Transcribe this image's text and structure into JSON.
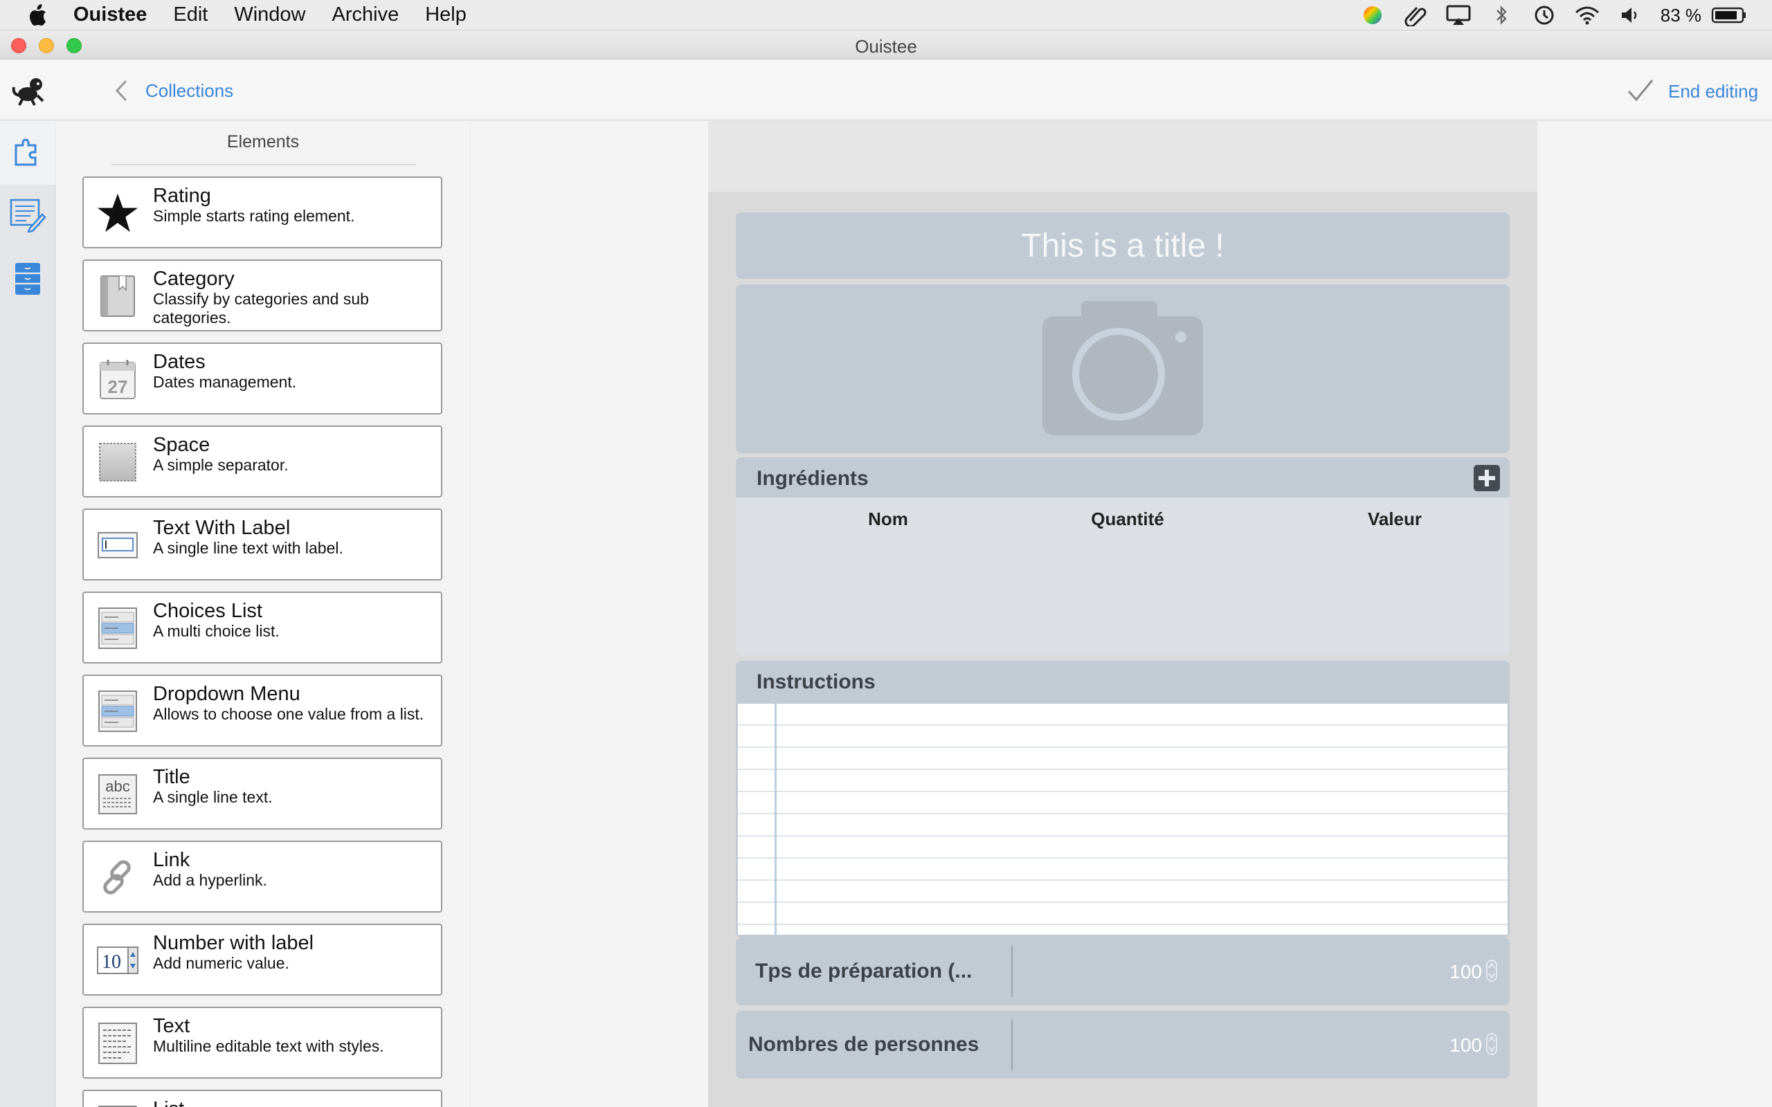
{
  "menubar": {
    "app_name": "Ouistee",
    "items": [
      "Edit",
      "Window",
      "Archive",
      "Help"
    ],
    "battery_percent": "83 %"
  },
  "window": {
    "title": "Ouistee"
  },
  "toolbar": {
    "back_label": "Collections",
    "end_editing_label": "End editing"
  },
  "elements_panel": {
    "title": "Elements",
    "items": [
      {
        "name": "Rating",
        "description": "Simple starts rating element.",
        "icon": "star-icon"
      },
      {
        "name": "Category",
        "description": "Classify by categories and sub categories.",
        "icon": "book-icon"
      },
      {
        "name": "Dates",
        "description": "Dates management.",
        "icon": "calendar-icon",
        "icon_text": "27"
      },
      {
        "name": "Space",
        "description": "A simple separator.",
        "icon": "space-icon"
      },
      {
        "name": "Text With Label",
        "description": "A single line text with label.",
        "icon": "text-field-icon"
      },
      {
        "name": "Choices List",
        "description": "A multi choice list.",
        "icon": "choices-list-icon"
      },
      {
        "name": "Dropdown Menu",
        "description": "Allows to choose one value from a list.",
        "icon": "dropdown-icon"
      },
      {
        "name": "Title",
        "description": "A single line text.",
        "icon": "title-icon",
        "icon_text": "abc"
      },
      {
        "name": "Link",
        "description": "Add a hyperlink.",
        "icon": "link-icon"
      },
      {
        "name": "Number with label",
        "description": "Add numeric value.",
        "icon": "number-stepper-icon",
        "icon_text": "10"
      },
      {
        "name": "Text",
        "description": "Multiline editable text with styles.",
        "icon": "text-doc-icon"
      },
      {
        "name": "List",
        "description": "",
        "icon": "list-icon"
      }
    ]
  },
  "form": {
    "title_text": "This is a title !",
    "photo_icon": "camera-icon",
    "ingredients": {
      "title": "Ingrédients",
      "columns": [
        "Nom",
        "Quantité",
        "Valeur"
      ]
    },
    "instructions": {
      "title": "Instructions"
    },
    "fields": [
      {
        "label": "Tps de préparation (...",
        "value": "100"
      },
      {
        "label": "Nombres de personnes",
        "value": "100"
      }
    ]
  },
  "colors": {
    "accent": "#3a86d9",
    "block": "#c2cad3",
    "page": "#dadada"
  }
}
